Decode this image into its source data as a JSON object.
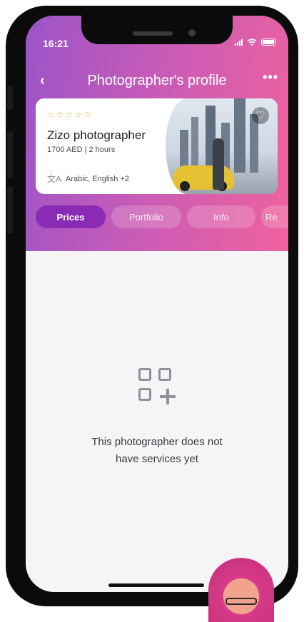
{
  "status_bar": {
    "time": "16:21"
  },
  "header": {
    "title": "Photographer's profile",
    "back_icon": "chevron-left-icon",
    "more_icon": "more-icon",
    "colors": {
      "gradient_start": "#9a54c8",
      "gradient_end": "#f0629e"
    }
  },
  "profile_card": {
    "stars": "☆☆☆☆☆",
    "name": "Zizo  photographer",
    "price": "1700 AED | 2 hours",
    "languages": "Arabic, English +2",
    "favorite_icon": "heart-icon",
    "language_icon": "translate-icon"
  },
  "tabs": [
    {
      "label": "Prices",
      "active": true
    },
    {
      "label": "Portfolio",
      "active": false
    },
    {
      "label": "Info",
      "active": false
    },
    {
      "label": "Re",
      "active": false
    }
  ],
  "empty_state": {
    "icon": "add-grid-icon",
    "message_line1": "This photographer does not",
    "message_line2": "have services yet"
  },
  "colors": {
    "active_tab": "#8a2bb5",
    "star": "#e3b23c",
    "background": "#f5f5f7"
  }
}
